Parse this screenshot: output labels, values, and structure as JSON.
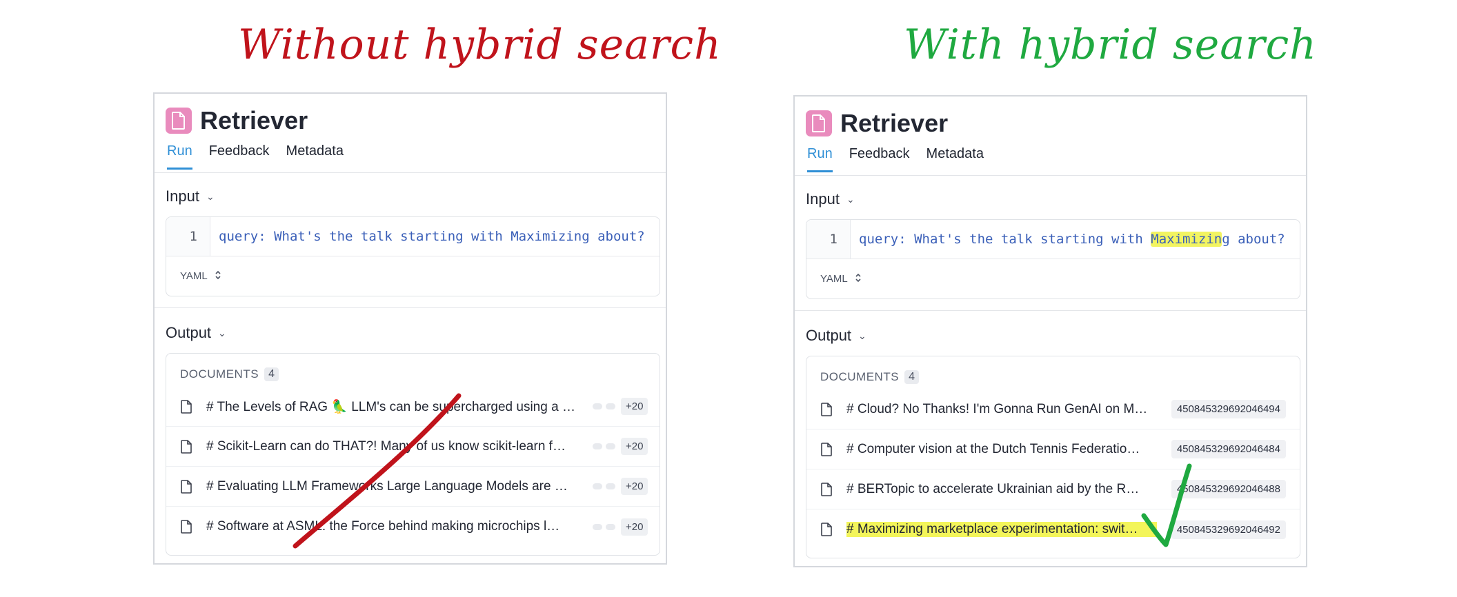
{
  "headings": {
    "left": "Without hybrid search",
    "right": "With hybrid search"
  },
  "colors": {
    "left_heading": "#c0131b",
    "right_heading": "#1fa940",
    "tab_active": "#2f8fd6",
    "highlight": "#f3f55a",
    "badge": "#e98bbd"
  },
  "left_panel": {
    "title": "Retriever",
    "tabs": [
      "Run",
      "Feedback",
      "Metadata"
    ],
    "input_label": "Input",
    "line_number": "1",
    "query": "query: What's the talk starting with Maximizing about?",
    "yaml_label": "YAML",
    "output_label": "Output",
    "documents_label": "DOCUMENTS",
    "documents_count": "4",
    "documents": [
      {
        "text": "# The Levels of RAG 🦜 LLM's can be supercharged using a …",
        "badge": "+20"
      },
      {
        "text": "# Scikit-Learn can do THAT?! Many of us know scikit-learn f…",
        "badge": "+20"
      },
      {
        "text": "# Evaluating LLM Frameworks Large Language Models are …",
        "badge": "+20"
      },
      {
        "text": "# Software at ASML: the Force behind making microchips l…",
        "badge": "+20"
      }
    ],
    "annotation_icon": "red-strike-icon"
  },
  "right_panel": {
    "title": "Retriever",
    "tabs": [
      "Run",
      "Feedback",
      "Metadata"
    ],
    "input_label": "Input",
    "line_number": "1",
    "query_before": "query: What's the talk starting with ",
    "query_highlight": "Maximizin",
    "query_after": "g about?",
    "yaml_label": "YAML",
    "output_label": "Output",
    "documents_label": "DOCUMENTS",
    "documents_count": "4",
    "documents": [
      {
        "text": "# Cloud? No Thanks! I'm Gonna Run GenAI on M…",
        "id": "450845329692046494"
      },
      {
        "text": "# Computer vision at the Dutch Tennis Federatio…",
        "id": "450845329692046484"
      },
      {
        "text": "# BERTopic to accelerate Ukrainian aid by the R…",
        "id": "450845329692046488"
      },
      {
        "text": "# Maximizing marketplace experimentation: swit…",
        "id": "450845329692046492"
      }
    ],
    "annotation_icon": "green-checkmark-icon"
  }
}
